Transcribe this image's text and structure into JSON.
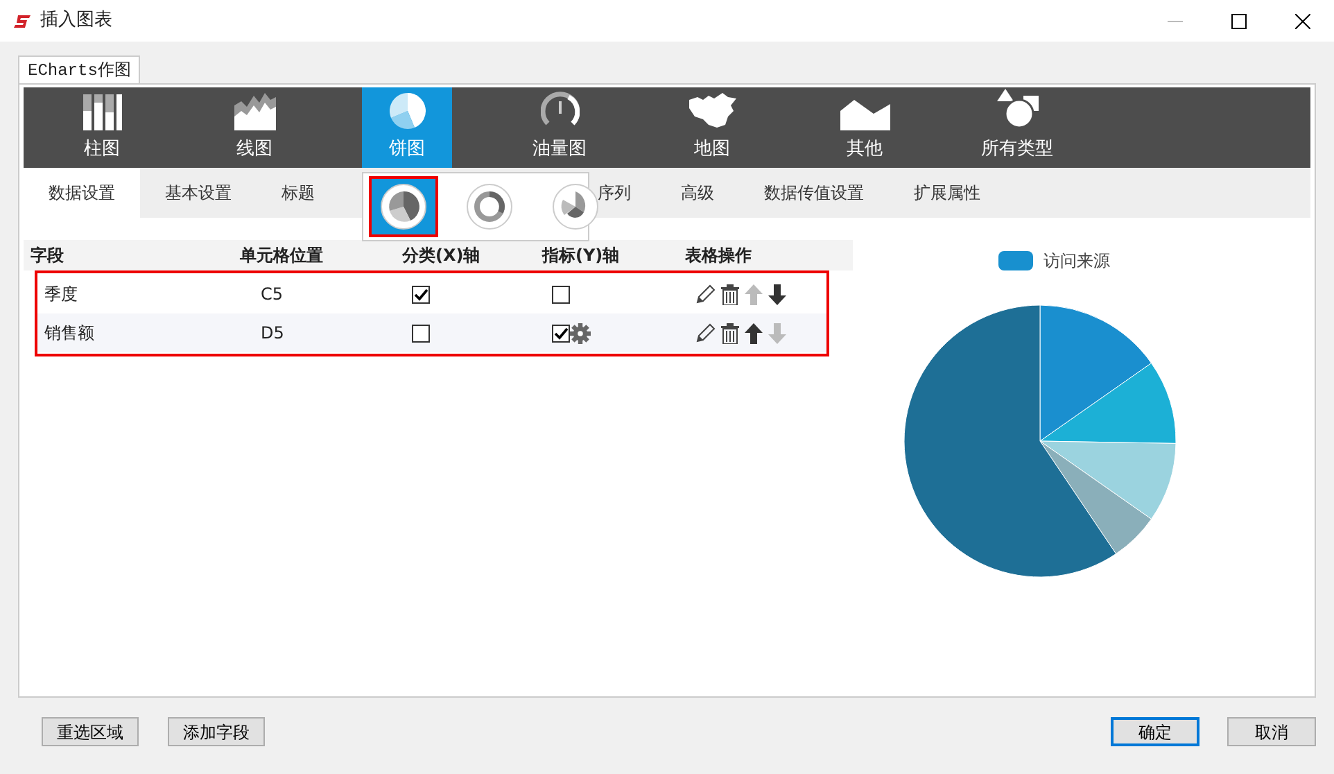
{
  "window": {
    "title": "插入图表"
  },
  "outer_tab": {
    "label": "ECharts作图",
    "selected": true
  },
  "chart_types": [
    {
      "label": "柱图",
      "kind": "bar",
      "selected": false
    },
    {
      "label": "线图",
      "kind": "line",
      "selected": false
    },
    {
      "label": "饼图",
      "kind": "pie",
      "selected": true
    },
    {
      "label": "油量图",
      "kind": "gauge",
      "selected": false
    },
    {
      "label": "地图",
      "kind": "map",
      "selected": false
    },
    {
      "label": "其他",
      "kind": "other",
      "selected": false
    },
    {
      "label": "所有类型",
      "kind": "all",
      "selected": false
    }
  ],
  "settings_tabs": [
    {
      "label": "数据设置",
      "selected": true
    },
    {
      "label": "基本设置",
      "selected": false
    },
    {
      "label": "标题",
      "selected": false
    },
    {
      "label": "序列",
      "selected": false,
      "gap_before": true
    },
    {
      "label": "高级",
      "selected": false
    },
    {
      "label": "数据传值设置",
      "selected": false
    },
    {
      "label": "扩展属性",
      "selected": false
    }
  ],
  "pie_variants": [
    {
      "kind": "pie",
      "selected": true
    },
    {
      "kind": "donut",
      "selected": false
    },
    {
      "kind": "rose",
      "selected": false
    }
  ],
  "table": {
    "columns": [
      "字段",
      "单元格位置",
      "分类(X)轴",
      "指标(Y)轴",
      "表格操作"
    ],
    "rows": [
      {
        "field": "季度",
        "cell": "C5",
        "x_axis": true,
        "y_axis": false,
        "up_enabled": false,
        "down_enabled": true
      },
      {
        "field": "销售额",
        "cell": "D5",
        "x_axis": false,
        "y_axis": true,
        "up_enabled": true,
        "down_enabled": false
      }
    ]
  },
  "preview": {
    "legend": "访问来源"
  },
  "buttons": [
    {
      "label": "重选区域",
      "kind": "left"
    },
    {
      "label": "添加字段",
      "kind": "left"
    },
    {
      "label": "确定",
      "kind": "default"
    },
    {
      "label": "取消",
      "kind": "right"
    }
  ]
}
